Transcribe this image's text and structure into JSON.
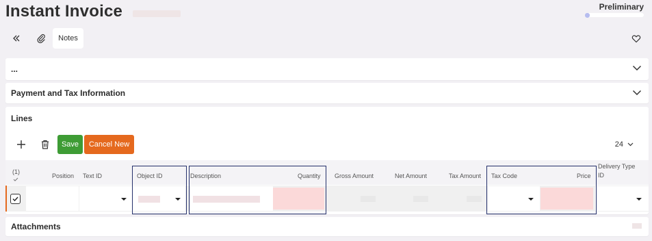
{
  "page": {
    "title": "Instant Invoice",
    "status": "Preliminary",
    "progress": 0.08
  },
  "toolbar": {
    "notes_label": "Notes",
    "icons": [
      "double-chevron-left-icon",
      "paperclip-icon",
      "heart-icon"
    ]
  },
  "sections": {
    "collapsed_title": "...",
    "payment_title": "Payment and Tax Information",
    "lines_title": "Lines",
    "attachments_title": "Attachments"
  },
  "lines": {
    "save_label": "Save",
    "cancel_new_label": "Cancel New",
    "page_size": "24",
    "selected_count": "(1)",
    "columns": {
      "position": "Position",
      "text_id": "Text ID",
      "object_id": "Object ID",
      "description": "Description",
      "quantity": "Quantity",
      "gross_amount": "Gross Amount",
      "net_amount": "Net Amount",
      "tax_amount": "Tax Amount",
      "tax_code": "Tax Code",
      "price": "Price",
      "delivery_type_id_1": "Delivery Type",
      "delivery_type_id_2": "ID"
    }
  },
  "colors": {
    "save": "#3e9c35",
    "cancel": "#e5691e",
    "required_field": "#fbd9d9",
    "highlight_border": "#24306b"
  }
}
